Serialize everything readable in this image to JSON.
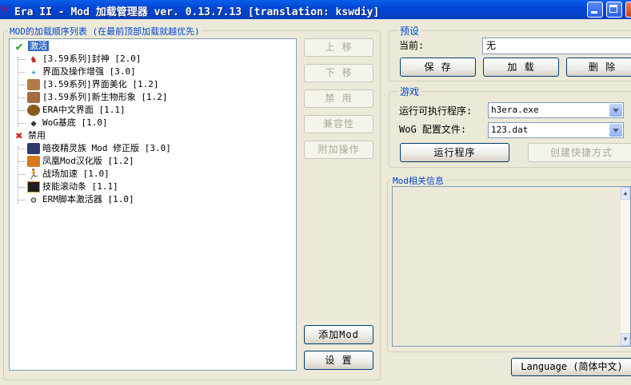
{
  "window": {
    "title": "Era II - Mod 加载管理器 ver. 0.13.7.13 [translation: kswdiy]"
  },
  "mod_list": {
    "group_label": "MOD的加载顺序列表 (在最前顶部加载就越优先)",
    "enabled_label": "激活",
    "disabled_label": "禁用",
    "enabled_items": [
      {
        "label": "[3.59系列]封神 [2.0]",
        "icon": "red-creature-icon"
      },
      {
        "label": "界面及操作增强 [3.0]",
        "icon": "sparkle-icon"
      },
      {
        "label": "[3.59系列]界面美化 [1.2]",
        "icon": "portrait-icon"
      },
      {
        "label": "[3.59系列]新生物形象 [1.2]",
        "icon": "portrait-icon"
      },
      {
        "label": "ERA中文界面 [1.1]",
        "icon": "shield-icon"
      },
      {
        "label": "WoG基底 [1.0]",
        "icon": "dragon-icon"
      }
    ],
    "disabled_items": [
      {
        "label": "暗夜精灵族 Mod 修正版 [3.0]",
        "icon": "night-elf-icon"
      },
      {
        "label": "凤凰Mod汉化版 [1.2]",
        "icon": "phoenix-icon"
      },
      {
        "label": "战场加速 [1.0]",
        "icon": "running-man-icon"
      },
      {
        "label": "技能滚动条 [1.1]",
        "icon": "scroll-bar-icon"
      },
      {
        "label": "ERM脚本激活器 [1.0]",
        "icon": "gear-icon"
      }
    ]
  },
  "side_buttons": {
    "move_up": "上 移",
    "move_down": "下 移",
    "disable": "禁 用",
    "compatibility": "兼容性",
    "extra_ops": "附加操作",
    "add_mod": "添加Mod",
    "settings": "设 置"
  },
  "presets": {
    "group_label": "预设",
    "current_label": "当前:",
    "current_value": "无",
    "save": "保 存",
    "load": "加 载",
    "delete": "删 除"
  },
  "game": {
    "group_label": "游戏",
    "exe_label": "运行可执行程序:",
    "exe_value": "h3era.exe",
    "config_label": "WoG 配置文件:",
    "config_value": "123.dat",
    "run_button": "运行程序",
    "shortcut_button": "创建快捷方式"
  },
  "info": {
    "group_label": "Mod相关信息"
  },
  "language_button": "Language (简体中文)",
  "colors": {
    "title_bar": "#0046d5",
    "selection": "#316ac5",
    "group_label": "#0046d5",
    "enabled_check": "#2a9d2a",
    "disabled_x": "#d8231f"
  }
}
